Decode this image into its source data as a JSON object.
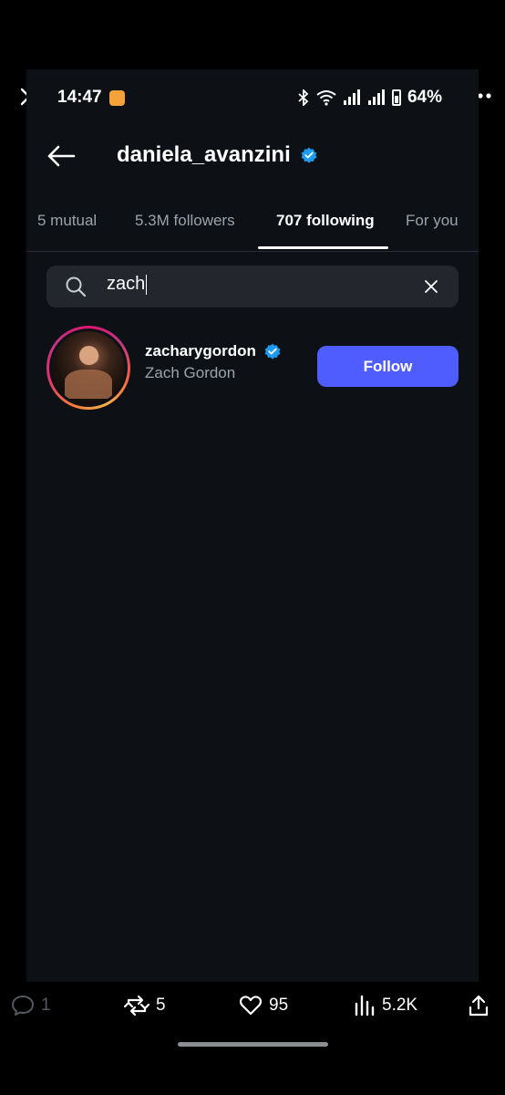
{
  "status_bar": {
    "time": "14:47",
    "battery": "64%"
  },
  "header": {
    "title": "daniela_avanzini"
  },
  "tabs": [
    {
      "label": "5 mutual"
    },
    {
      "label": "5.3M followers"
    },
    {
      "label": "707 following"
    },
    {
      "label": "For you"
    }
  ],
  "search": {
    "value": "zach"
  },
  "result": {
    "username": "zacharygordon",
    "full_name": "Zach Gordon",
    "follow_label": "Follow"
  },
  "actions": {
    "replies": "1",
    "reposts": "5",
    "likes": "95",
    "views": "5.2K"
  },
  "colors": {
    "background": "#0d1116",
    "accent": "#4f5dff",
    "verified": "#1d9bf0"
  }
}
